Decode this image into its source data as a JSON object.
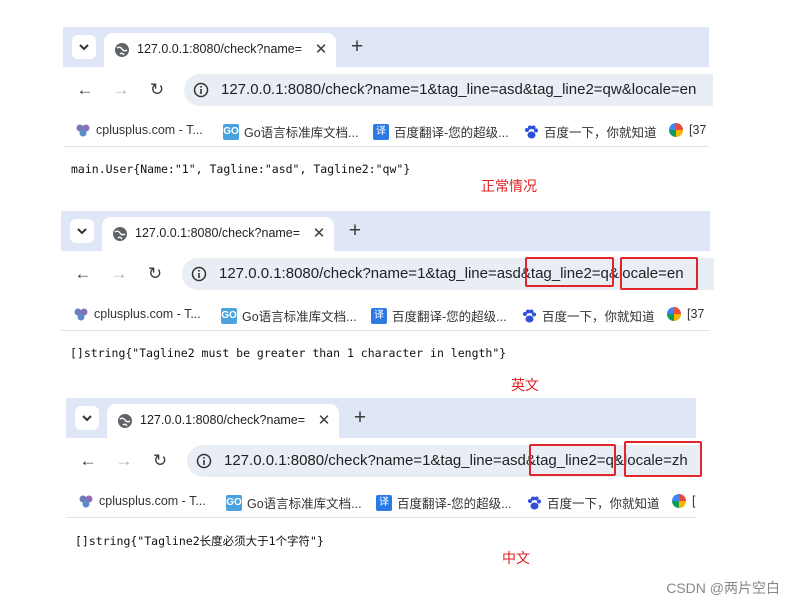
{
  "screenshots": [
    {
      "tab_title": "127.0.0.1:8080/check?name=",
      "url": "127.0.0.1:8080/check?name=1&tag_line=asd&tag_line2=qw&locale=en",
      "bookmarks": [
        "cplusplus.com - T...",
        "Go语言标准库文档...",
        "百度翻译-您的超级...",
        "百度一下，你就知道",
        "[37"
      ],
      "output": "main.User{Name:\"1\", Tagline:\"asd\", Tagline2:\"qw\"}",
      "caption": "正常情况"
    },
    {
      "tab_title": "127.0.0.1:8080/check?name=",
      "url": "127.0.0.1:8080/check?name=1&tag_line=asd&tag_line2=q&locale=en",
      "bookmarks": [
        "cplusplus.com - T...",
        "Go语言标准库文档...",
        "百度翻译-您的超级...",
        "百度一下，你就知道",
        "[37"
      ],
      "output": "[]string{\"Tagline2 must be greater than 1 character in length\"}",
      "caption": "英文"
    },
    {
      "tab_title": "127.0.0.1:8080/check?name=",
      "url": "127.0.0.1:8080/check?name=1&tag_line=asd&tag_line2=q&locale=zh",
      "bookmarks": [
        "cplusplus.com - T...",
        "Go语言标准库文档...",
        "百度翻译-您的超级...",
        "百度一下，你就知道",
        "["
      ],
      "output": "[]string{\"Tagline2长度必须大于1个字符\"}",
      "caption": "中文"
    }
  ],
  "watermark": "CSDN @两片空白",
  "colors": {
    "tabstrip": "#dfe7f7",
    "omnibox": "#e9eef5",
    "highlight": "#e0252b",
    "caption": "#e02020"
  }
}
